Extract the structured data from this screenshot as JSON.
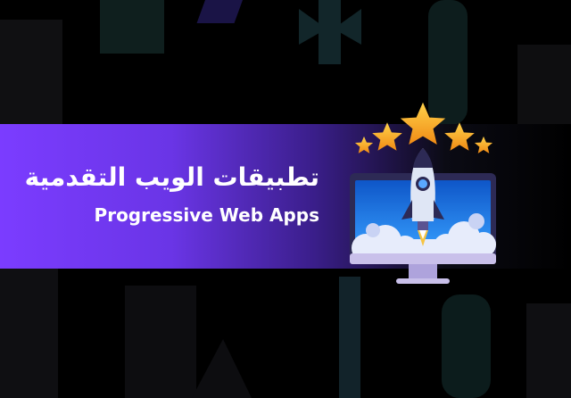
{
  "title": {
    "arabic": "تطبيقات الويب التقدمية",
    "english": "Progressive Web Apps"
  },
  "colors": {
    "background": "#000000",
    "band_start": "#7b3cff",
    "band_end": "#000000",
    "star": "#f6a91c",
    "monitor_frame": "#2d2a55",
    "screen": "#1a6fe0",
    "rocket_body": "#dfe6f5",
    "stand": "#c9c0ea"
  },
  "icons": [
    "rocket-icon",
    "star-icon",
    "monitor-icon",
    "cloud-icon"
  ]
}
